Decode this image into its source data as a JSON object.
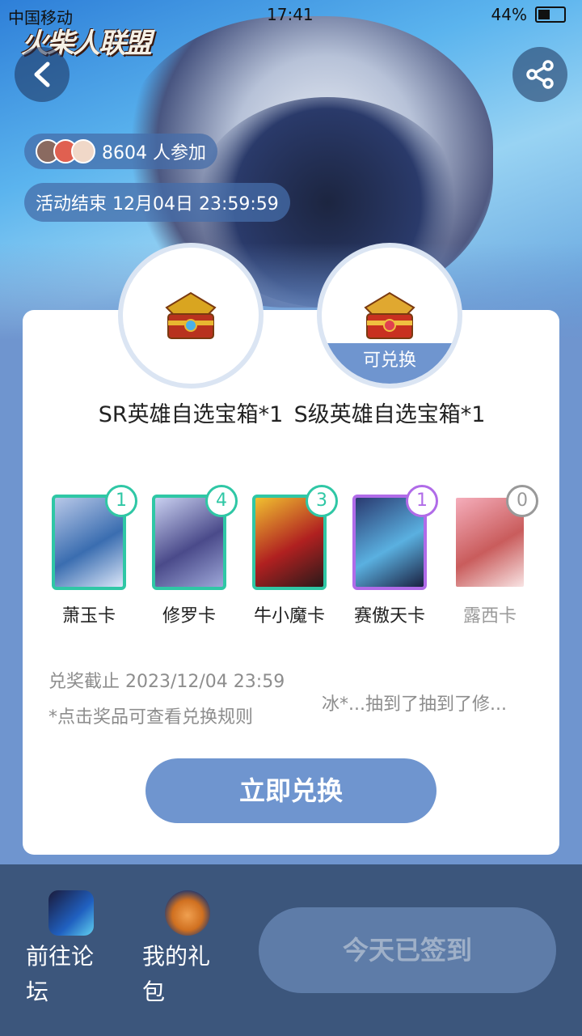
{
  "status_bar": {
    "carrier": "中国移动",
    "time": "17:41",
    "battery": "44%"
  },
  "header": {
    "logo_text": "火柴人联盟",
    "participants_count": "8604 人参加",
    "end_time": "活动结束 12月04日 23:59:59"
  },
  "prizes": [
    {
      "name": "SR英雄自选宝箱*1",
      "tag": ""
    },
    {
      "name": "S级英雄自选宝箱*1",
      "tag": "可兑换"
    }
  ],
  "heroes": [
    {
      "label": "萧玉卡",
      "count": "1",
      "style": "green",
      "colors": [
        "#b8c8e8",
        "#3a6db0",
        "#dbe6f8"
      ]
    },
    {
      "label": "修罗卡",
      "count": "4",
      "style": "green",
      "colors": [
        "#c9d0f0",
        "#4a4a8a",
        "#9da7d8"
      ]
    },
    {
      "label": "牛小魔卡",
      "count": "3",
      "style": "green",
      "colors": [
        "#f0c030",
        "#b02020",
        "#2a1a1a"
      ]
    },
    {
      "label": "赛傲天卡",
      "count": "1",
      "style": "purple",
      "colors": [
        "#2a3a70",
        "#5ab0e0",
        "#1a2040"
      ]
    },
    {
      "label": "露西卡",
      "count": "0",
      "style": "none",
      "colors": [
        "#f4a0b0",
        "#c04040",
        "#f8e0e0"
      ]
    }
  ],
  "info": {
    "deadline": "兑奖截止 2023/12/04 23:59",
    "note": "*点击奖品可查看兑换规则",
    "ticker": "冰*...抽到了抽到了修..."
  },
  "redeem_button": "立即兑换",
  "bottom_nav": {
    "forum_label_line1": "前往论",
    "forum_label_line2": "坛",
    "gift_label_line1": "我的礼",
    "gift_label_line2": "包",
    "signed_button": "今天已签到",
    "forum_icon": "game-app-icon",
    "gift_icon": "gift-pack-icon"
  },
  "colors": {
    "accent": "#6f95cf",
    "teal": "#2fc7a5",
    "purple": "#b06be8",
    "bottom_bar": "#3c567c"
  }
}
